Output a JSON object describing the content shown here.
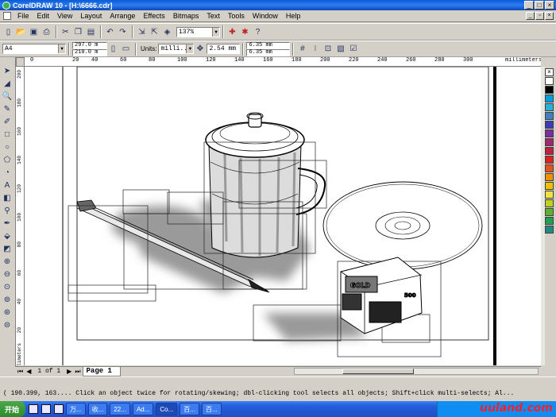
{
  "window": {
    "title": "CorelDRAW 10 - [H:\\6666.cdr]"
  },
  "menu": [
    "File",
    "Edit",
    "View",
    "Layout",
    "Arrange",
    "Effects",
    "Bitmaps",
    "Text",
    "Tools",
    "Window",
    "Help"
  ],
  "toolbar": {
    "zoom": "137%"
  },
  "property_bar": {
    "page_size": "A4",
    "width": "297.0 m",
    "height": "210.0 m",
    "units_label": "Units:",
    "units": "milli...",
    "nudge": "2.54 mm",
    "dup_x": "6.35 mm",
    "dup_y": "6.35 mm"
  },
  "ruler": {
    "unit": "millimeters",
    "ticks": [
      "0",
      "20",
      "40",
      "60",
      "80",
      "100",
      "120",
      "140",
      "160",
      "180",
      "200",
      "220",
      "240",
      "260",
      "280",
      "300"
    ],
    "v_ticks": [
      "200",
      "180",
      "160",
      "140",
      "120",
      "100",
      "80",
      "60",
      "40",
      "20"
    ],
    "v_unit": "millimeters"
  },
  "page_nav": {
    "page_count": "1 of 1",
    "tab": "Page 1"
  },
  "status": {
    "text": "( 190.399, 163.... Click an object twice for rotating/skewing; dbl-clicking tool selects all objects; Shift+click multi-selects; Al..."
  },
  "taskbar": {
    "start": "开始",
    "tasks": [
      "万...",
      "收...",
      "22...",
      "Ad...",
      "Co...",
      "百...",
      "百..."
    ]
  },
  "brand": "uuland.com",
  "box": {
    "line1": "GOLD",
    "line2": "500"
  },
  "palette": [
    "#ffffff",
    "#000000",
    "#00a0e0",
    "#2ab0d8",
    "#4080c0",
    "#3c3cb4",
    "#7830a0",
    "#a0286e",
    "#c02040",
    "#e02020",
    "#e85020",
    "#f09000",
    "#f0c000",
    "#f0e040",
    "#c0d020",
    "#60b030",
    "#20a050",
    "#208a80"
  ]
}
